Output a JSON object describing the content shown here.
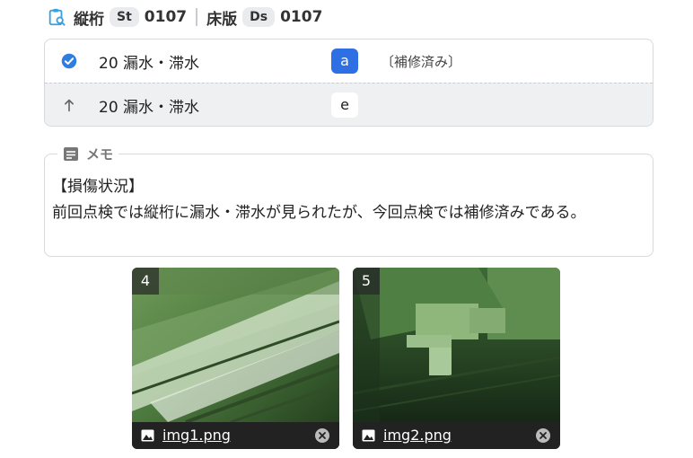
{
  "header": {
    "label1": "縦桁",
    "badge1": "St",
    "num1": "0107",
    "label2": "床版",
    "badge2": "Ds",
    "num2": "0107"
  },
  "conditions": [
    {
      "icon": "check-circle-icon",
      "text": "20 漏水・滞水",
      "grade": "a",
      "note": "〔補修済み〕"
    },
    {
      "icon": "arrow-up-icon",
      "text": "20 漏水・滞水",
      "grade": "e",
      "note": ""
    }
  ],
  "memo": {
    "label": "メモ",
    "heading": "【損傷状況】",
    "body": "前回点検では縦桁に漏水・滞水が見られたが、今回点検では補修済みである。"
  },
  "photos": [
    {
      "number": "4",
      "filename": "img1.png"
    },
    {
      "number": "5",
      "filename": "img2.png"
    }
  ],
  "colors": {
    "accent": "#2f6fe4",
    "check": "#2f7de1"
  }
}
